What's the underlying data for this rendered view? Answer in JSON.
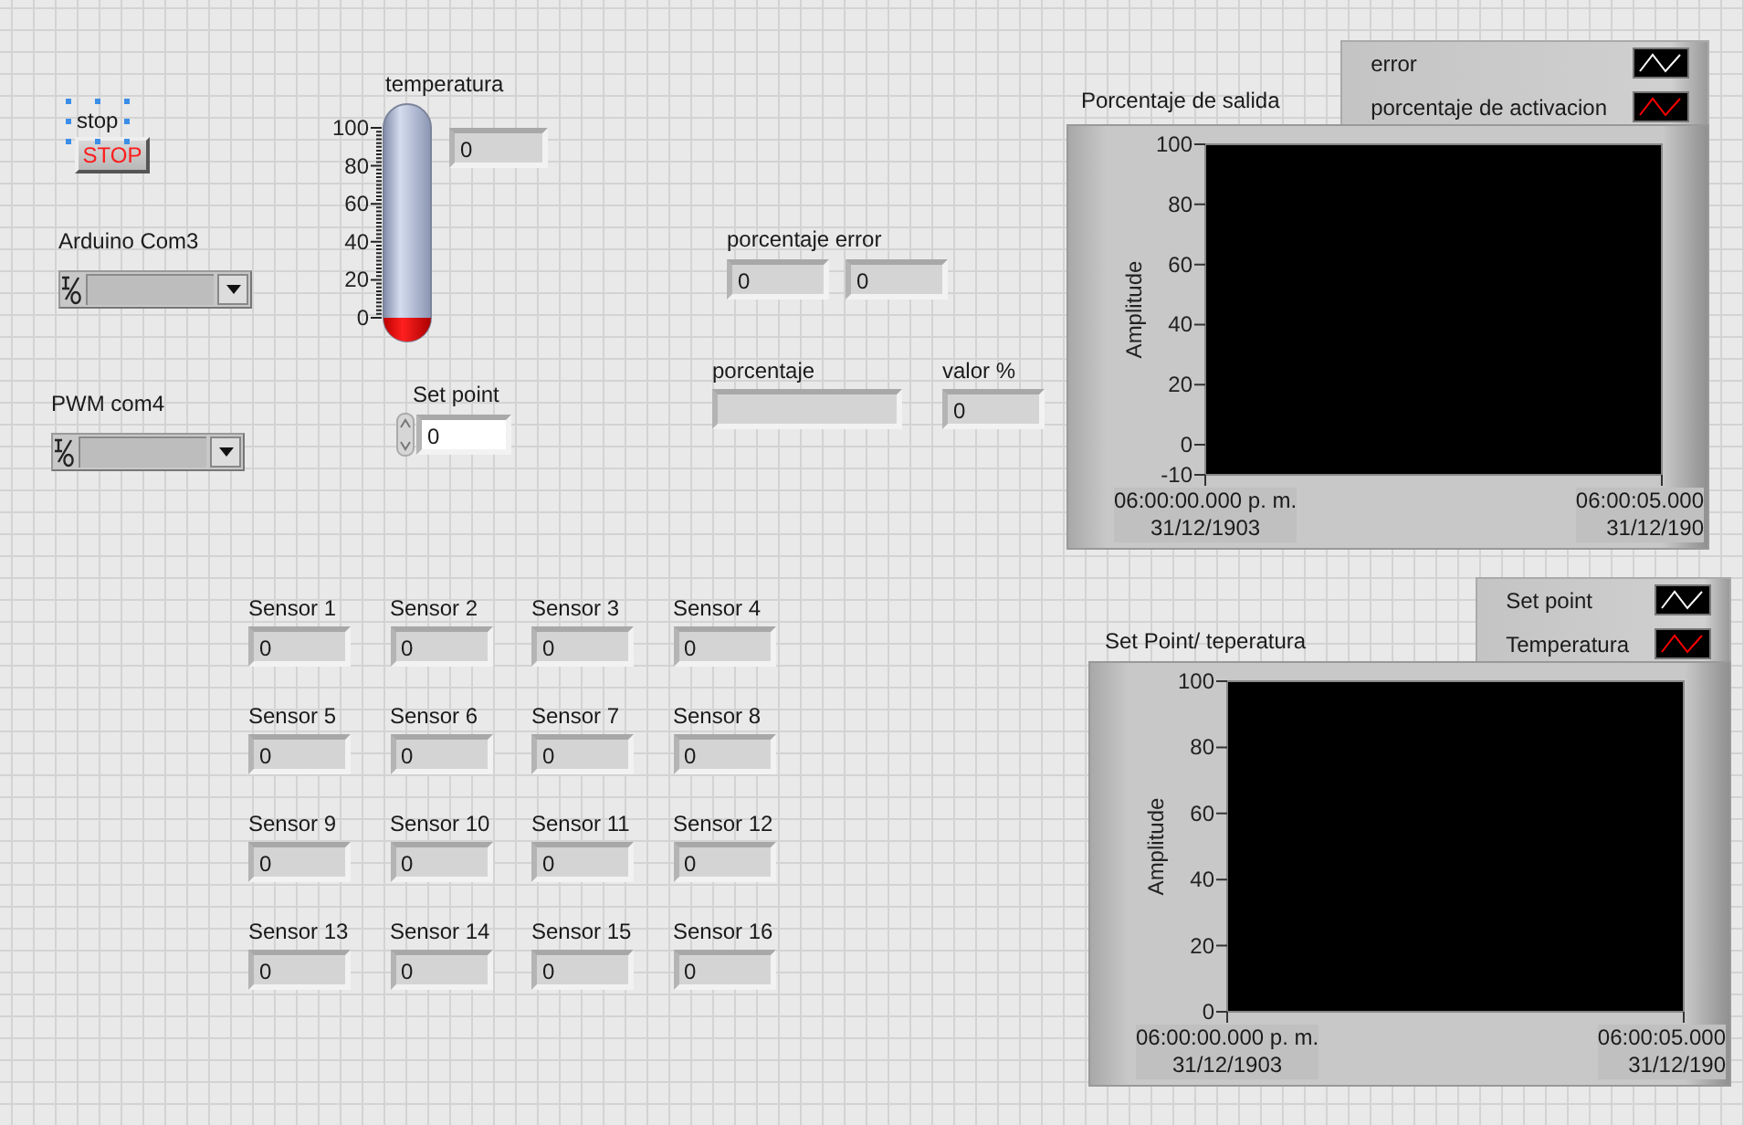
{
  "stop": {
    "label": "stop",
    "button": "STOP",
    "selected": true
  },
  "ports": [
    {
      "label": "Arduino Com3"
    },
    {
      "label": "PWM com4"
    }
  ],
  "temperatura": {
    "label": "temperatura",
    "level": 0,
    "scale": [
      "100",
      "80",
      "60",
      "40",
      "20",
      "0"
    ],
    "value": "0"
  },
  "set_point": {
    "label": "Set point",
    "value": "0"
  },
  "porcentaje_error": {
    "label": "porcentaje error",
    "values": [
      "0",
      "0"
    ]
  },
  "porcentaje": {
    "label": "porcentaje"
  },
  "valor": {
    "label": "valor %",
    "value": "0"
  },
  "sensors": [
    {
      "label": "Sensor 1",
      "value": "0"
    },
    {
      "label": "Sensor 2",
      "value": "0"
    },
    {
      "label": "Sensor 3",
      "value": "0"
    },
    {
      "label": "Sensor 4",
      "value": "0"
    },
    {
      "label": "Sensor 5",
      "value": "0"
    },
    {
      "label": "Sensor 6",
      "value": "0"
    },
    {
      "label": "Sensor 7",
      "value": "0"
    },
    {
      "label": "Sensor 8",
      "value": "0"
    },
    {
      "label": "Sensor 9",
      "value": "0"
    },
    {
      "label": "Sensor 10",
      "value": "0"
    },
    {
      "label": "Sensor 11",
      "value": "0"
    },
    {
      "label": "Sensor 12",
      "value": "0"
    },
    {
      "label": "Sensor 13",
      "value": "0"
    },
    {
      "label": "Sensor 14",
      "value": "0"
    },
    {
      "label": "Sensor 15",
      "value": "0"
    },
    {
      "label": "Sensor 16",
      "value": "0"
    }
  ],
  "charts": [
    {
      "title": "Porcentaje de salida",
      "legend": [
        {
          "name": "error",
          "color": "#ffffff"
        },
        {
          "name": "porcentaje de activacion",
          "color": "#ff0000"
        }
      ],
      "chart_data": {
        "type": "line",
        "ylabel": "Amplitude",
        "ylim": [
          -10,
          100
        ],
        "yticks": [
          -10,
          0,
          20,
          40,
          60,
          80,
          100
        ],
        "categories": [
          "06:00:00.000 p. m.\n31/12/1903",
          "06:00:05.000\n31/12/190"
        ]
      }
    },
    {
      "title": "Set Point/ teperatura",
      "legend": [
        {
          "name": "Set point",
          "color": "#ffffff"
        },
        {
          "name": "Temperatura",
          "color": "#ff0000"
        }
      ],
      "chart_data": {
        "type": "line",
        "ylabel": "Amplitude",
        "ylim": [
          0,
          100
        ],
        "yticks": [
          0,
          20,
          40,
          60,
          80,
          100
        ],
        "categories": [
          "06:00:00.000 p. m.\n31/12/1903",
          "06:00:05.000\n31/12/190"
        ]
      }
    }
  ]
}
